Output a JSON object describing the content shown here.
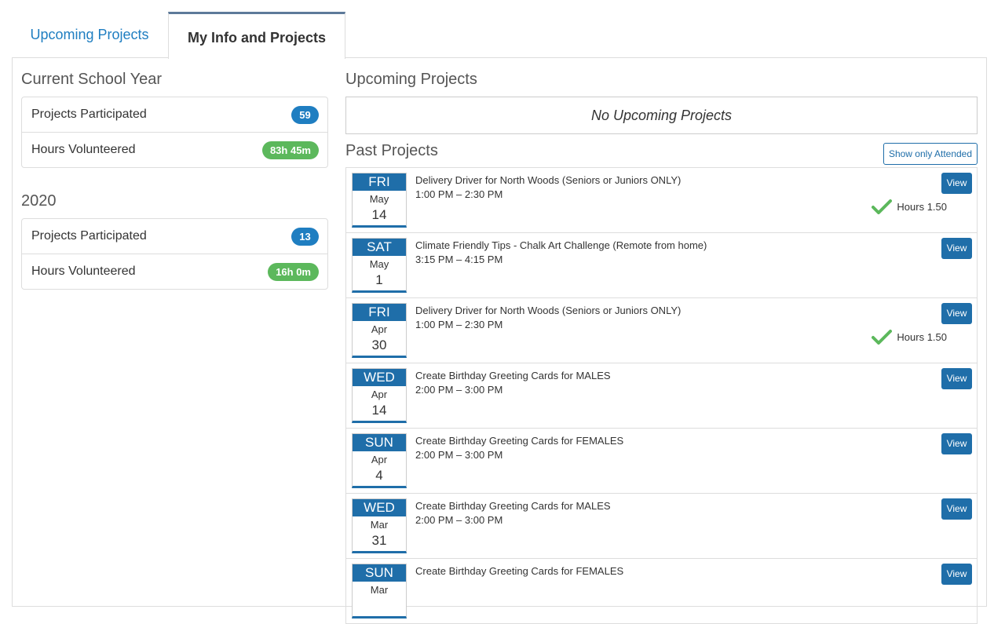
{
  "tabs": {
    "upcoming": "Upcoming Projects",
    "my_info": "My Info and Projects"
  },
  "current_year": {
    "title": "Current School Year",
    "projects_label": "Projects Participated",
    "projects_value": "59",
    "hours_label": "Hours Volunteered",
    "hours_value": "83h 45m"
  },
  "year_2020": {
    "title": "2020",
    "projects_label": "Projects Participated",
    "projects_value": "13",
    "hours_label": "Hours Volunteered",
    "hours_value": "16h 0m"
  },
  "upcoming": {
    "title": "Upcoming Projects",
    "empty_text": "No Upcoming Projects"
  },
  "past": {
    "title": "Past Projects",
    "filter_button": "Show only Attended",
    "view_label": "View",
    "items": [
      {
        "day": "FRI",
        "month": "May",
        "date": "14",
        "title": "Delivery Driver for North Woods (Seniors or Juniors ONLY)",
        "time": "1:00 PM – 2:30 PM",
        "hours": "Hours 1.50"
      },
      {
        "day": "SAT",
        "month": "May",
        "date": "1",
        "title": "Climate Friendly Tips - Chalk Art Challenge (Remote from home)",
        "time": "3:15 PM – 4:15 PM",
        "hours": ""
      },
      {
        "day": "FRI",
        "month": "Apr",
        "date": "30",
        "title": "Delivery Driver for North Woods (Seniors or Juniors ONLY)",
        "time": "1:00 PM – 2:30 PM",
        "hours": "Hours 1.50"
      },
      {
        "day": "WED",
        "month": "Apr",
        "date": "14",
        "title": "Create Birthday Greeting Cards for MALES",
        "time": "2:00 PM – 3:00 PM",
        "hours": ""
      },
      {
        "day": "SUN",
        "month": "Apr",
        "date": "4",
        "title": "Create Birthday Greeting Cards for FEMALES",
        "time": "2:00 PM – 3:00 PM",
        "hours": ""
      },
      {
        "day": "WED",
        "month": "Mar",
        "date": "31",
        "title": "Create Birthday Greeting Cards for MALES",
        "time": "2:00 PM – 3:00 PM",
        "hours": ""
      },
      {
        "day": "SUN",
        "month": "Mar",
        "date": "",
        "title": "Create Birthday Greeting Cards for FEMALES",
        "time": "",
        "hours": ""
      }
    ]
  },
  "colors": {
    "accent": "#1f6ea9",
    "link": "#1f7ec1",
    "success": "#5cb85c"
  }
}
